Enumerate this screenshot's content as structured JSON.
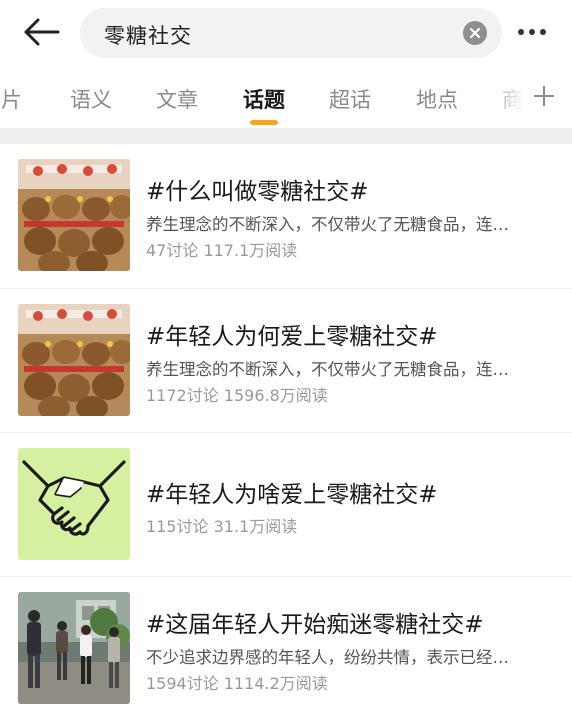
{
  "search": {
    "query": "零糖社交"
  },
  "tabs": [
    {
      "label": "图片"
    },
    {
      "label": "语义"
    },
    {
      "label": "文章"
    },
    {
      "label": "话题"
    },
    {
      "label": "超话"
    },
    {
      "label": "地点"
    },
    {
      "label": "商"
    }
  ],
  "active_tab": "话题",
  "colors": {
    "accent": "#f5a623",
    "separator": "#efefef",
    "meta": "#999999"
  },
  "results": [
    {
      "title": "#什么叫做零糖社交#",
      "desc": "养生理念的不断深入，不仅带火了无糖食品，连…",
      "meta": "47讨论 117.1万阅读",
      "thumb": "capybara-plush-photo"
    },
    {
      "title": "#年轻人为何爱上零糖社交#",
      "desc": "养生理念的不断深入，不仅带火了无糖食品，连…",
      "meta": "1172讨论 1596.8万阅读",
      "thumb": "capybara-plush-photo"
    },
    {
      "title": "#年轻人为啥爱上零糖社交#",
      "desc": "",
      "meta": "115讨论 31.1万阅读",
      "thumb": "handshake-icon"
    },
    {
      "title": "#这届年轻人开始痴迷零糖社交#",
      "desc": "不少追求边界感的年轻人，纷纷共情，表示已经…",
      "meta": "1594讨论 1114.2万阅读",
      "thumb": "people-greeting-photo"
    }
  ]
}
